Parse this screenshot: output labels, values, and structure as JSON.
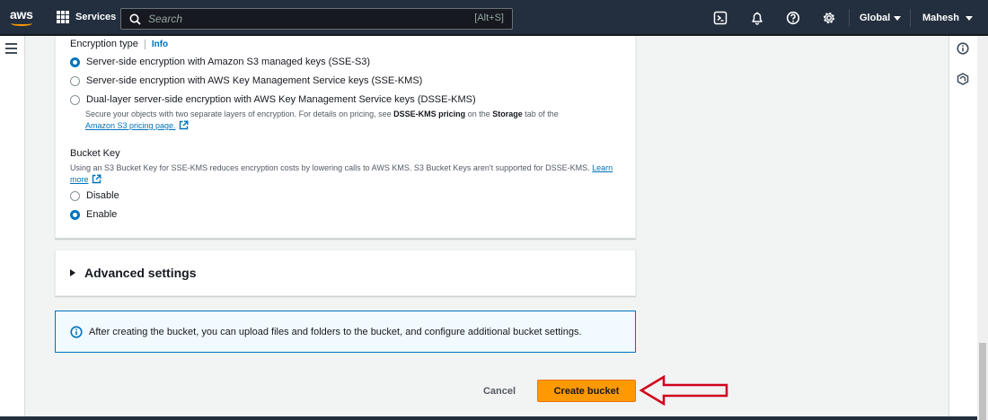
{
  "topnav": {
    "logo_text": "aws",
    "services_label": "Services",
    "search_placeholder": "Search",
    "search_shortcut": "[Alt+S]",
    "region_label": "Global",
    "user_label": "Mahesh",
    "icons": [
      "cloudshell-icon",
      "bell-icon",
      "help-icon",
      "gear-icon"
    ]
  },
  "encryption": {
    "label": "Encryption type",
    "info_label": "Info",
    "options": [
      {
        "label": "Server-side encryption with Amazon S3 managed keys (SSE-S3)",
        "checked": true
      },
      {
        "label": "Server-side encryption with AWS Key Management Service keys (SSE-KMS)",
        "checked": false
      },
      {
        "label": "Dual-layer server-side encryption with AWS Key Management Service keys (DSSE-KMS)",
        "checked": false
      }
    ],
    "dsse_desc_pre": "Secure your objects with two separate layers of encryption. For details on pricing, see ",
    "dsse_desc_bold1": "DSSE-KMS pricing",
    "dsse_desc_mid": " on the ",
    "dsse_desc_bold2": "Storage",
    "dsse_desc_post": " tab of the",
    "dsse_link": "Amazon S3 pricing page."
  },
  "bucket_key": {
    "title": "Bucket Key",
    "desc": "Using an S3 Bucket Key for SSE-KMS reduces encryption costs by lowering calls to AWS KMS. S3 Bucket Keys aren't supported for DSSE-KMS.",
    "learn_more": "Learn more",
    "options": [
      {
        "label": "Disable",
        "checked": false
      },
      {
        "label": "Enable",
        "checked": true
      }
    ]
  },
  "advanced": {
    "title": "Advanced settings"
  },
  "alert": {
    "message": "After creating the bucket, you can upload files and folders to the bucket, and configure additional bucket settings."
  },
  "actions": {
    "cancel_label": "Cancel",
    "create_label": "Create bucket"
  },
  "colors": {
    "nav_bg": "#232f3e",
    "primary_button": "#ff9900",
    "link": "#0073bb",
    "annotation_arrow": "#d0021b"
  }
}
